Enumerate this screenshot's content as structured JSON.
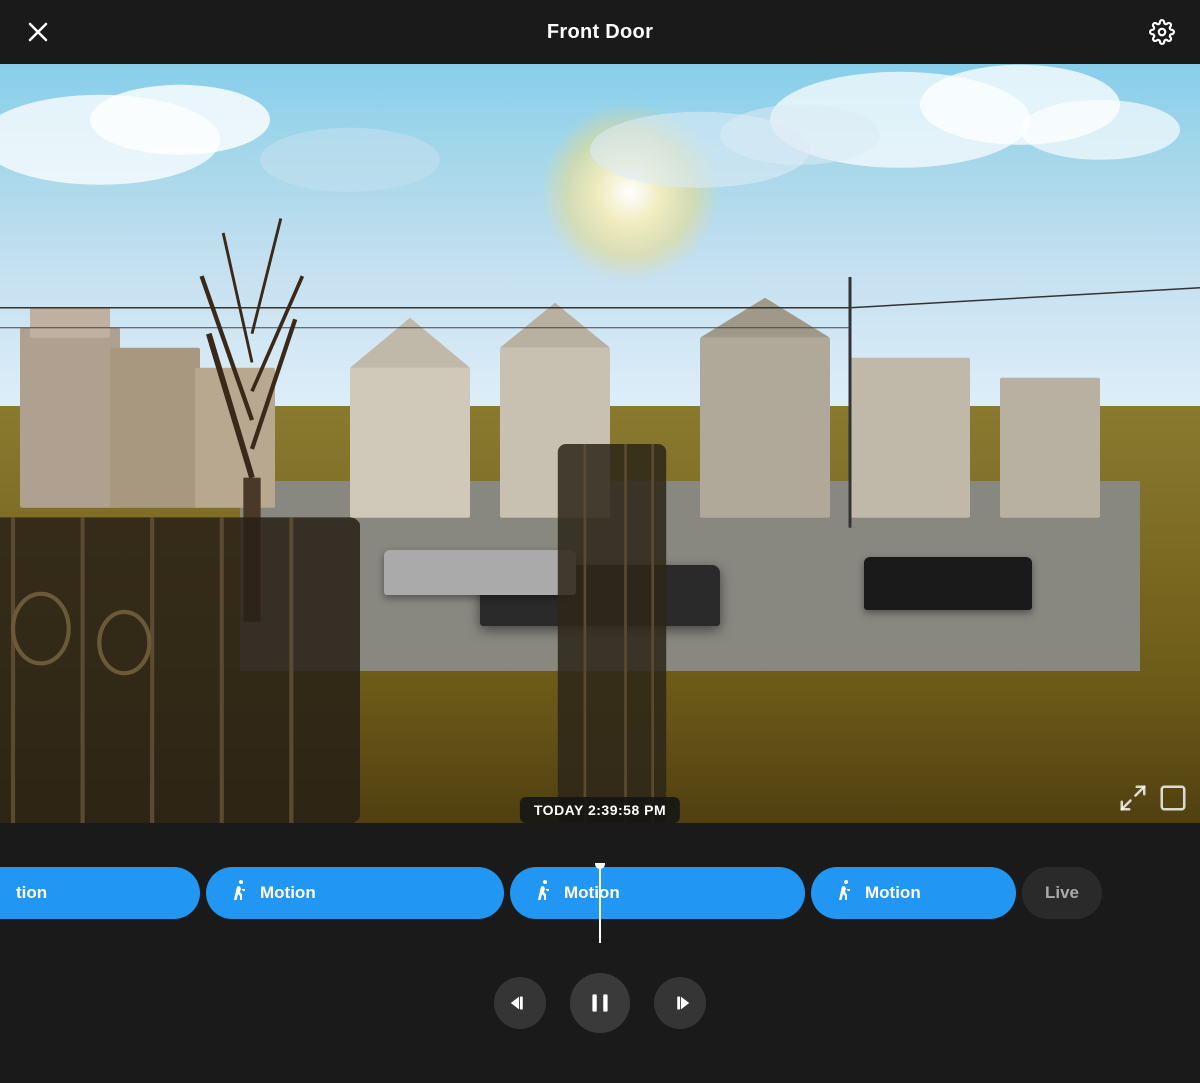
{
  "header": {
    "title": "Front Door",
    "close_label": "Close",
    "settings_label": "Settings"
  },
  "video": {
    "timestamp": "TODAY 2:39:58 PM"
  },
  "timeline": {
    "chips": [
      {
        "id": "motion-0",
        "label": "tion",
        "partial": true,
        "type": "motion"
      },
      {
        "id": "motion-1",
        "label": "Motion",
        "partial": false,
        "type": "motion"
      },
      {
        "id": "motion-2",
        "label": "Motion",
        "partial": false,
        "type": "motion"
      },
      {
        "id": "motion-3",
        "label": "Motion",
        "partial": false,
        "type": "motion"
      },
      {
        "id": "live",
        "label": "Live",
        "partial": false,
        "type": "live"
      }
    ]
  },
  "controls": {
    "rewind_label": "Rewind",
    "pause_label": "Pause",
    "forward_label": "Forward Skip"
  },
  "colors": {
    "motion_chip_bg": "#2196F3",
    "live_chip_bg": "#2a2a2a",
    "header_bg": "#1a1a1a",
    "bottom_bg": "#1a1a1a"
  }
}
